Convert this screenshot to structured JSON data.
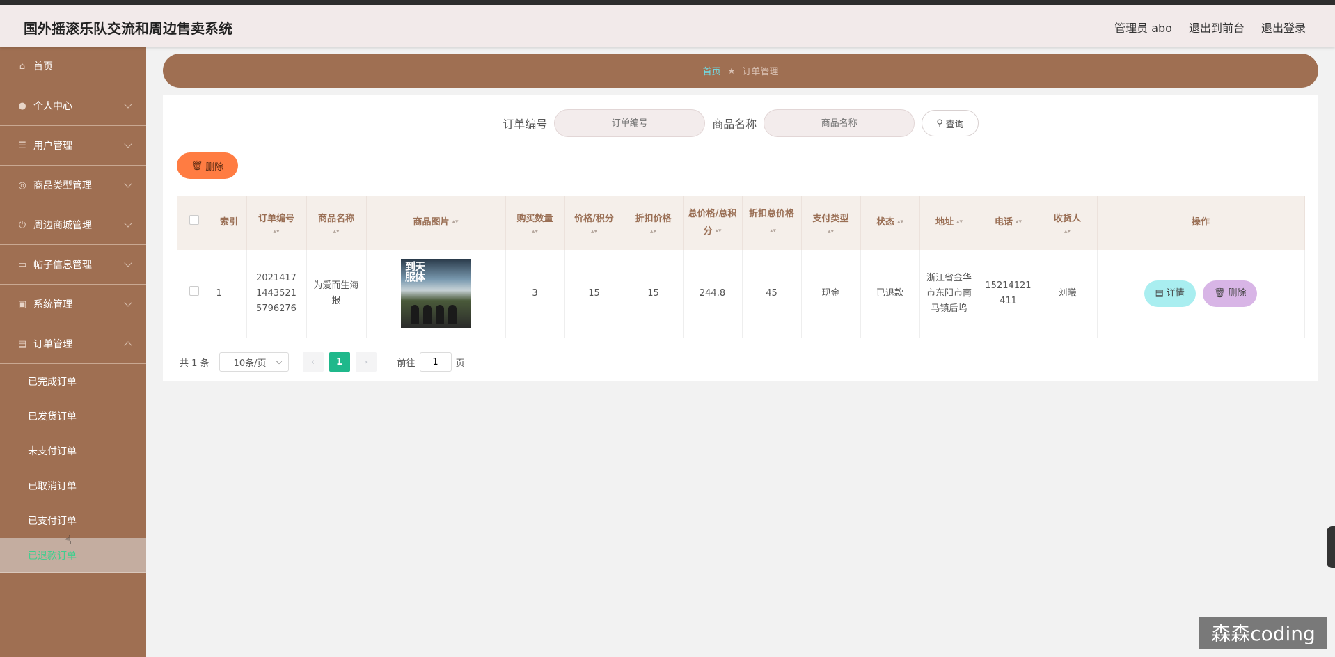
{
  "header": {
    "title": "国外摇滚乐队交流和周边售卖系统",
    "admin_label": "管理员 abo",
    "to_front": "退出到前台",
    "logout": "退出登录"
  },
  "sidebar": {
    "items": [
      {
        "label": "首页",
        "icon": "home-icon"
      },
      {
        "label": "个人中心",
        "icon": "user-icon"
      },
      {
        "label": "用户管理",
        "icon": "sliders-icon"
      },
      {
        "label": "商品类型管理",
        "icon": "target-icon"
      },
      {
        "label": "周边商城管理",
        "icon": "power-icon"
      },
      {
        "label": "帖子信息管理",
        "icon": "monitor-icon"
      },
      {
        "label": "系统管理",
        "icon": "picture-icon"
      },
      {
        "label": "订单管理",
        "icon": "briefcase-icon"
      }
    ],
    "sub_items": [
      "已完成订单",
      "已发货订单",
      "未支付订单",
      "已取消订单",
      "已支付订单",
      "已退款订单"
    ]
  },
  "breadcrumb": {
    "home": "首页",
    "separator": "★",
    "current": "订单管理"
  },
  "search": {
    "order_no_label": "订单编号",
    "order_no_placeholder": "订单编号",
    "product_name_label": "商品名称",
    "product_name_placeholder": "商品名称",
    "query_button": "查询"
  },
  "toolbar": {
    "delete_label": "删除"
  },
  "table": {
    "headers": [
      "索引",
      "订单编号",
      "商品名称",
      "商品图片",
      "购买数量",
      "价格/积分",
      "折扣价格",
      "总价格/总积分",
      "折扣总价格",
      "支付类型",
      "状态",
      "地址",
      "电话",
      "收货人",
      "操作"
    ],
    "rows": [
      {
        "index": "1",
        "order_no": "20214171443521579 6276",
        "order_no_display": "2021417\n1443521\n5796276",
        "product_name": "为爱而生海报",
        "image_text": "到天\n服体",
        "quantity": "3",
        "price": "15",
        "discount_price": "15",
        "total_price": "244.8",
        "discount_total": "45",
        "pay_type": "现金",
        "status": "已退款",
        "address": "浙江省金华市东阳市南马镇后坞",
        "phone": "15214121411",
        "receiver": "刘曦",
        "detail_button": "详情",
        "delete_button": "删除"
      }
    ]
  },
  "pager": {
    "total": "共 1 条",
    "page_size": "10条/页",
    "current_page": "1",
    "goto_prefix": "前往",
    "goto_value": "1",
    "goto_suffix": "页"
  },
  "watermark": "森森coding",
  "colors": {
    "sidebar": "#9f6f52",
    "accent": "#1fb88b",
    "danger": "#ff7c42",
    "detail": "#a9eef0",
    "delete": "#d8b5e6"
  }
}
